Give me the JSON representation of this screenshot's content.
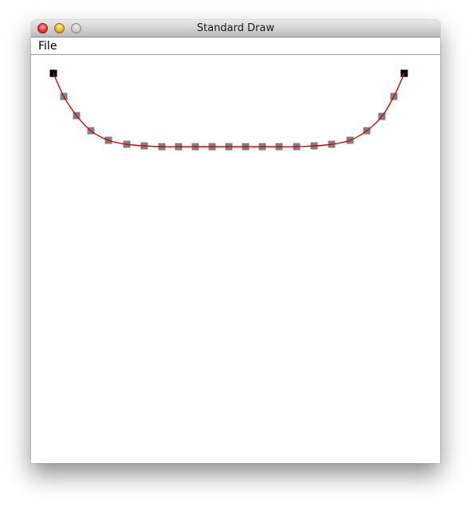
{
  "window": {
    "title": "Standard Draw"
  },
  "menubar": {
    "file_label": "File"
  },
  "icons": {
    "close": "close-button-icon",
    "minimize": "minimize-button-icon",
    "zoom": "zoom-button-icon"
  },
  "colors": {
    "curve": "#e00000",
    "control_point": "#808080",
    "endpoint": "#000000"
  }
}
